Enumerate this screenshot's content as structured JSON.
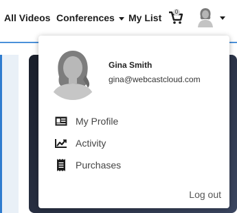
{
  "nav": {
    "all_videos": "All Videos",
    "conferences": "Conferences",
    "my_list": "My List",
    "cart_count": "0"
  },
  "user": {
    "name": "Gina Smith",
    "email": "gina@webcastcloud.com"
  },
  "menu": [
    {
      "label": "My Profile",
      "icon": "id-card-icon"
    },
    {
      "label": "Activity",
      "icon": "trend-chart-icon"
    },
    {
      "label": "Purchases",
      "icon": "receipt-icon"
    }
  ],
  "logout_label": "Log out",
  "colors": {
    "accent_line": "#4a90d9",
    "text_dark": "#1c1c1c"
  }
}
